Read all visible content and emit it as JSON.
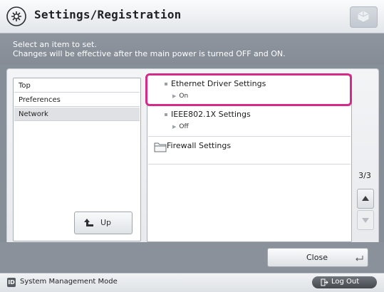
{
  "header": {
    "title": "Settings/Registration",
    "logo_icon": "settings-gear-icon",
    "corner_icon": "cube-icon"
  },
  "message": {
    "line1": "Select an item to set.",
    "line2": "Changes will be effective after the main power is turned OFF and ON."
  },
  "tree": {
    "items": [
      {
        "label": "Top"
      },
      {
        "label": "Preferences"
      },
      {
        "label": "Network"
      }
    ],
    "selected": "Network",
    "up_label": "Up"
  },
  "list": {
    "items": [
      {
        "label": "Ethernet Driver Settings",
        "value": "On",
        "highlighted": true
      },
      {
        "label": "IEEE802.1X Settings",
        "value": "Off"
      },
      {
        "label": "Firewall Settings",
        "icon": "folder-icon"
      }
    ],
    "highlight_color": "#d42a8a"
  },
  "pager": {
    "text": "3/3"
  },
  "footer": {
    "close_label": "Close"
  },
  "status": {
    "badge": "ID",
    "mode": "System Management Mode",
    "logout_label": "Log Out"
  }
}
